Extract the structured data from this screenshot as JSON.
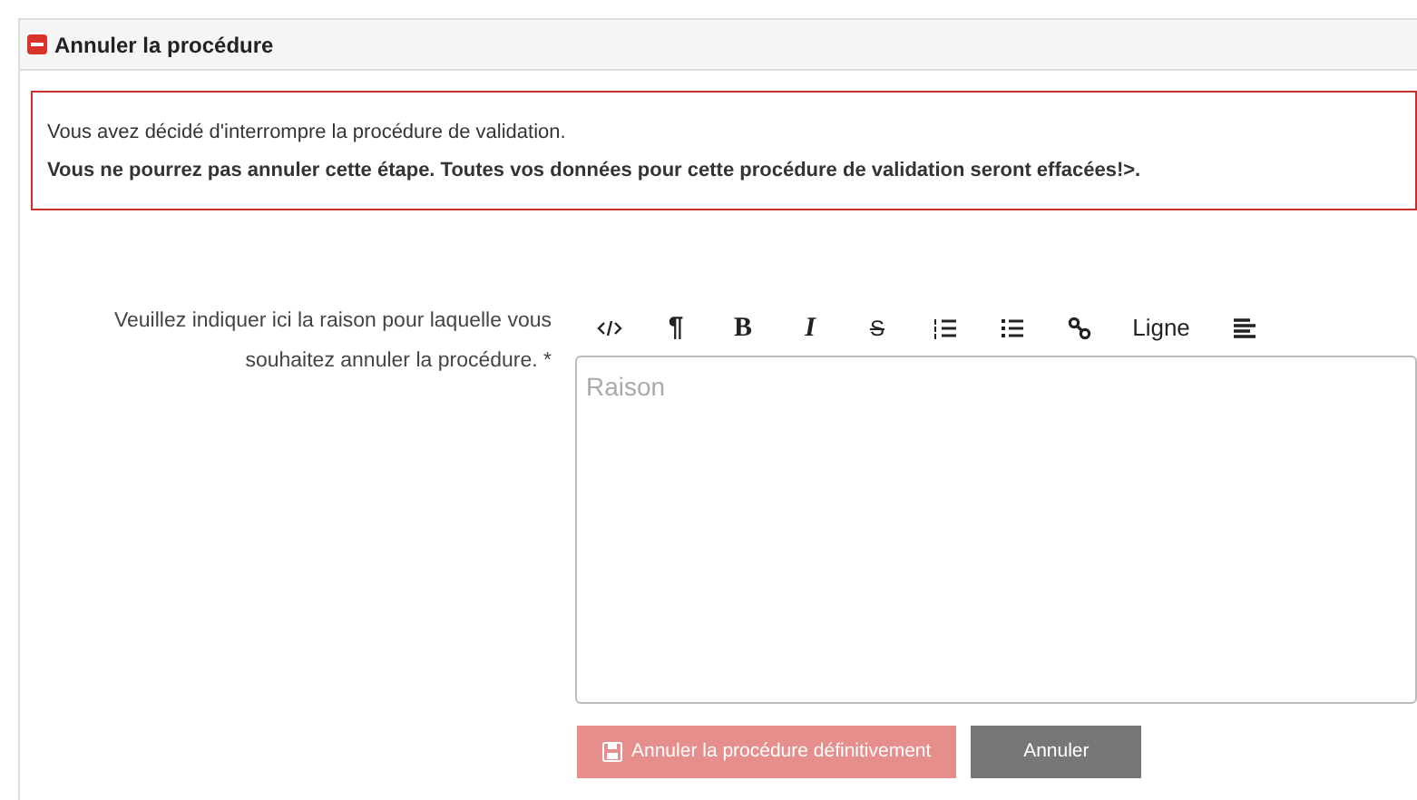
{
  "panel": {
    "title": "Annuler la procédure"
  },
  "alert": {
    "message": "Vous avez décidé d'interrompre la procédure de validation.",
    "warning": "Vous ne pourrez pas annuler cette étape. Toutes vos données pour cette procédure de validation seront effacées!>."
  },
  "form": {
    "label": "Veuillez indiquer ici la raison pour laquelle vous souhaitez annuler la procédure. *",
    "toolbar": [
      {
        "kind": "code"
      },
      {
        "kind": "paragraph",
        "label": "¶"
      },
      {
        "kind": "bold",
        "label": "B"
      },
      {
        "kind": "italic",
        "label": "I"
      },
      {
        "kind": "strike",
        "label": "S"
      },
      {
        "kind": "ordered"
      },
      {
        "kind": "bullets"
      },
      {
        "kind": "link"
      },
      {
        "kind": "text",
        "label": "Ligne"
      },
      {
        "kind": "align"
      }
    ],
    "editor": {
      "placeholder": "Raison"
    }
  },
  "buttons": [
    {
      "kind": "danger",
      "label": "Annuler la procédure définitivement",
      "disabled": true
    },
    {
      "kind": "secondary",
      "label": "Annuler",
      "disabled": false
    }
  ]
}
